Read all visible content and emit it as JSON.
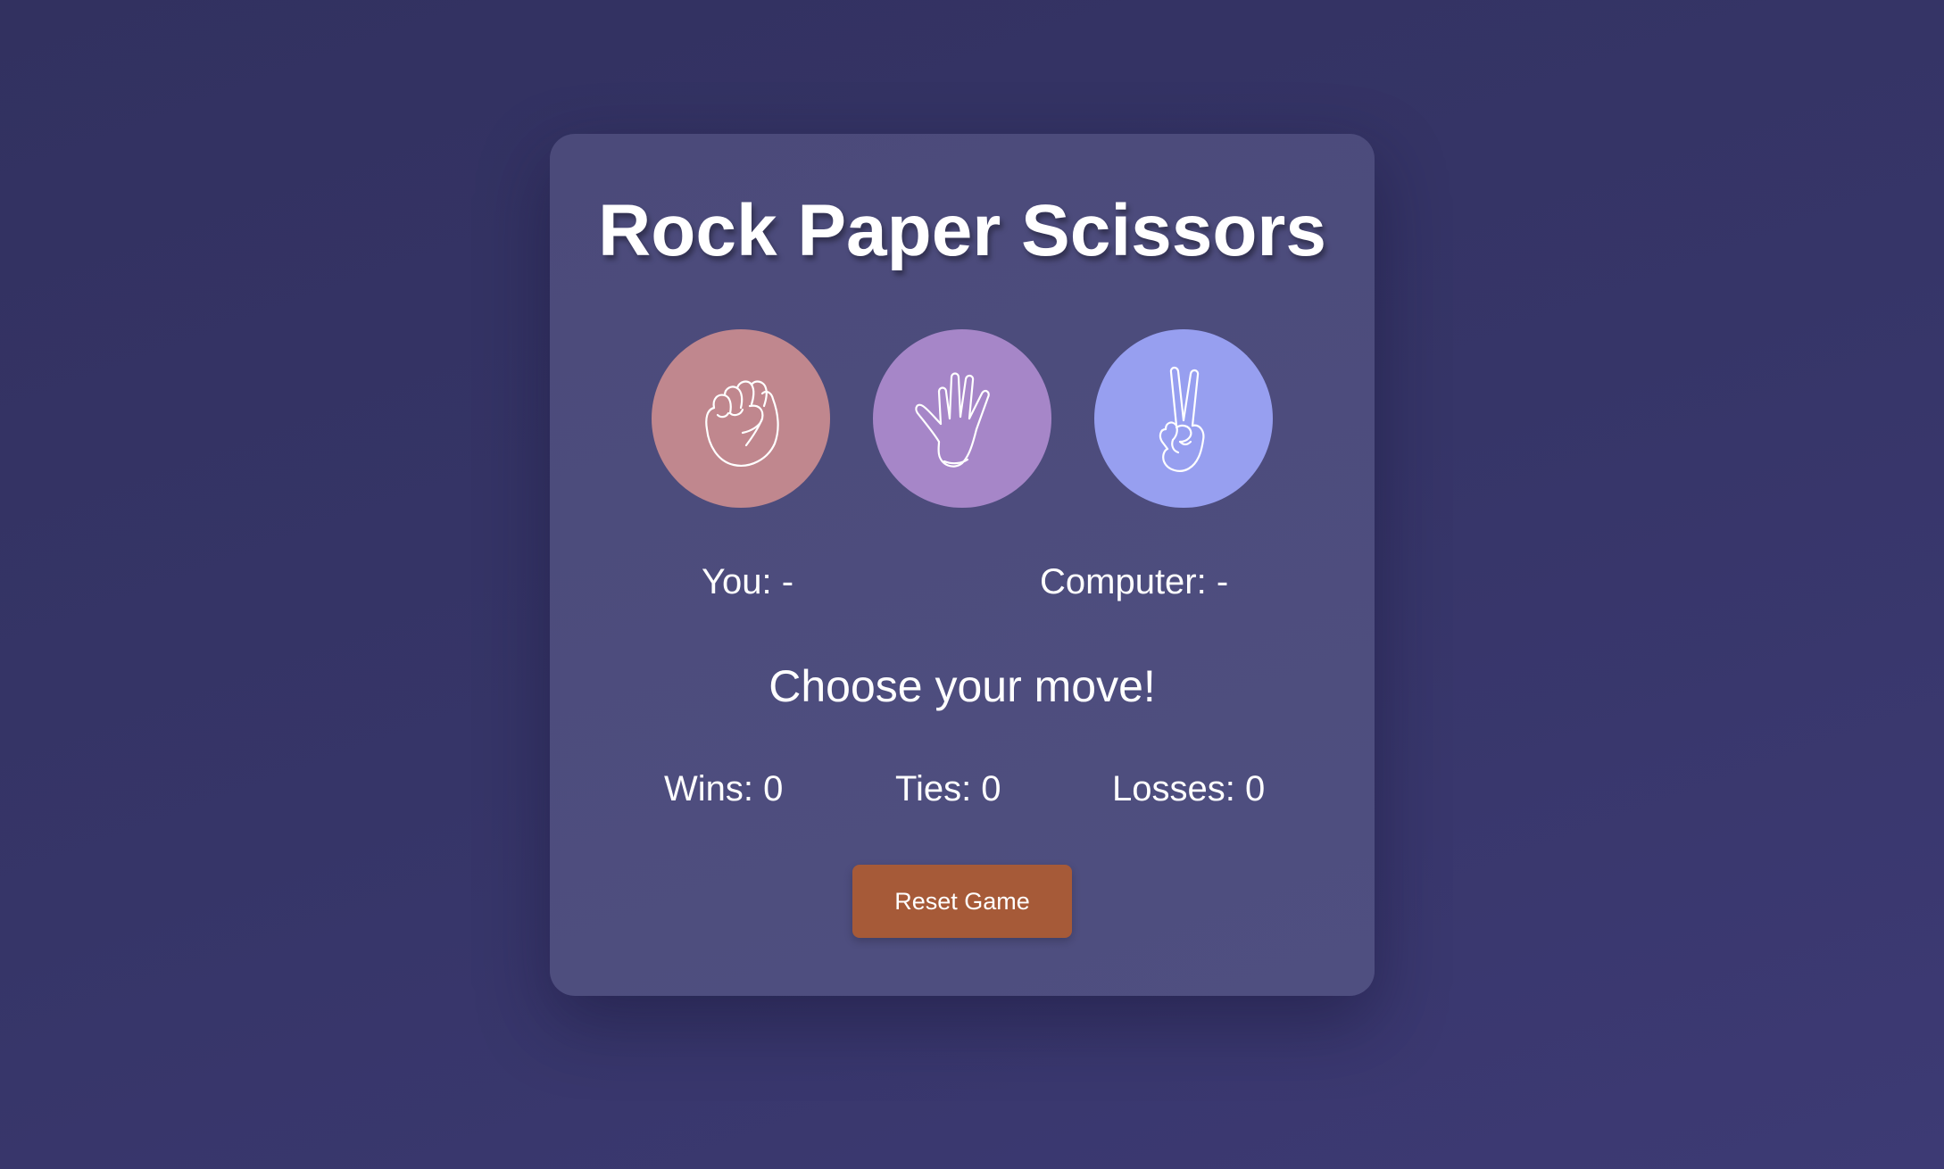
{
  "title": "Rock Paper Scissors",
  "moves": [
    {
      "name": "rock",
      "icon": "fist-icon",
      "color": "#c0878e"
    },
    {
      "name": "paper",
      "icon": "open-hand-icon",
      "color": "#a686c8"
    },
    {
      "name": "scissors",
      "icon": "peace-hand-icon",
      "color": "#979ff0"
    }
  ],
  "player_choice": "You: -",
  "computer_choice": "Computer: -",
  "message": "Choose your move!",
  "score": {
    "wins": "Wins: 0",
    "ties": "Ties: 0",
    "losses": "Losses: 0"
  },
  "reset_label": "Reset Game",
  "colors": {
    "background": "#343363",
    "card": "#4b4a7a",
    "reset_button": "#a65a38",
    "text": "#ffffff"
  }
}
